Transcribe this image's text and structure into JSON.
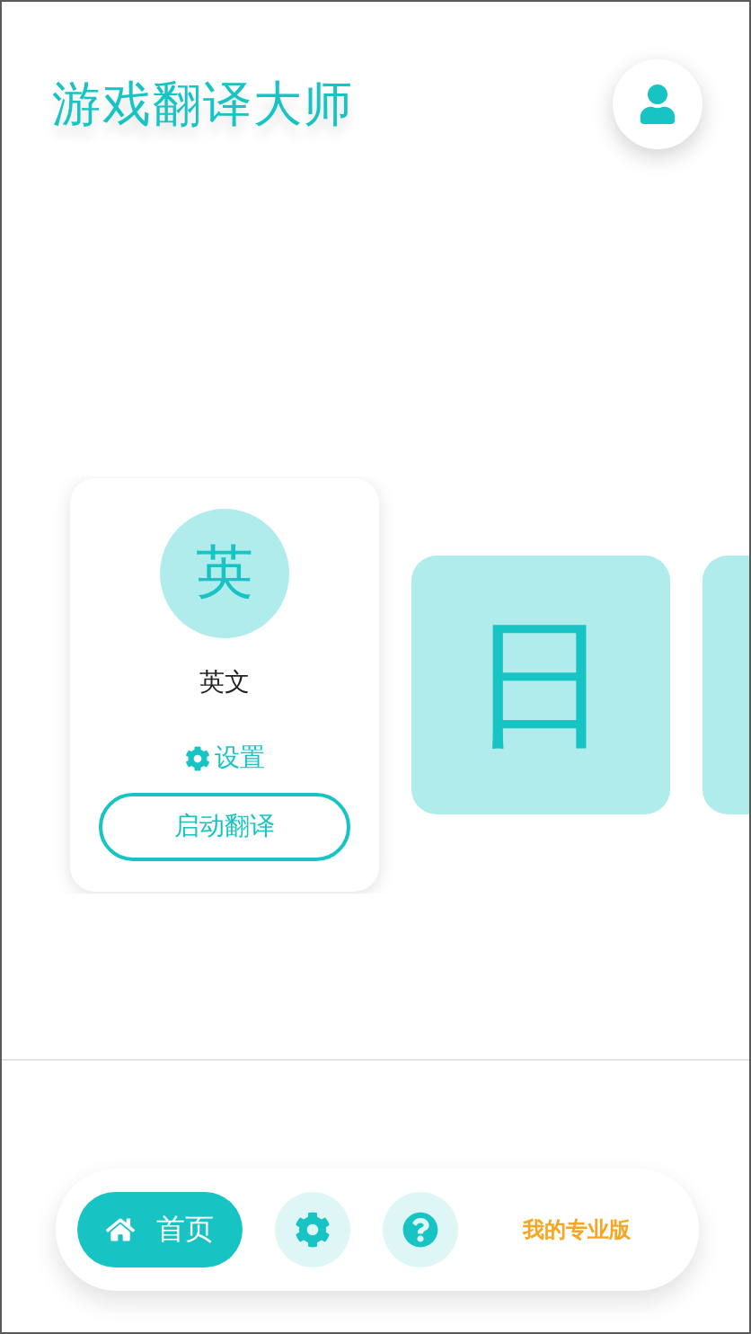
{
  "app_title": "游戏翻译大师",
  "languages": [
    {
      "glyph": "英",
      "name": "英文",
      "settings": "设置",
      "action": "启动翻译",
      "selected": true
    },
    {
      "glyph": "日",
      "selected": false
    },
    {
      "selected": false
    }
  ],
  "nav": [
    {
      "kind": "home",
      "label": "首页",
      "selected": true
    },
    {
      "kind": "settings",
      "selected": false
    },
    {
      "kind": "help",
      "selected": false
    },
    {
      "kind": "link",
      "label": "我的专业版"
    }
  ]
}
